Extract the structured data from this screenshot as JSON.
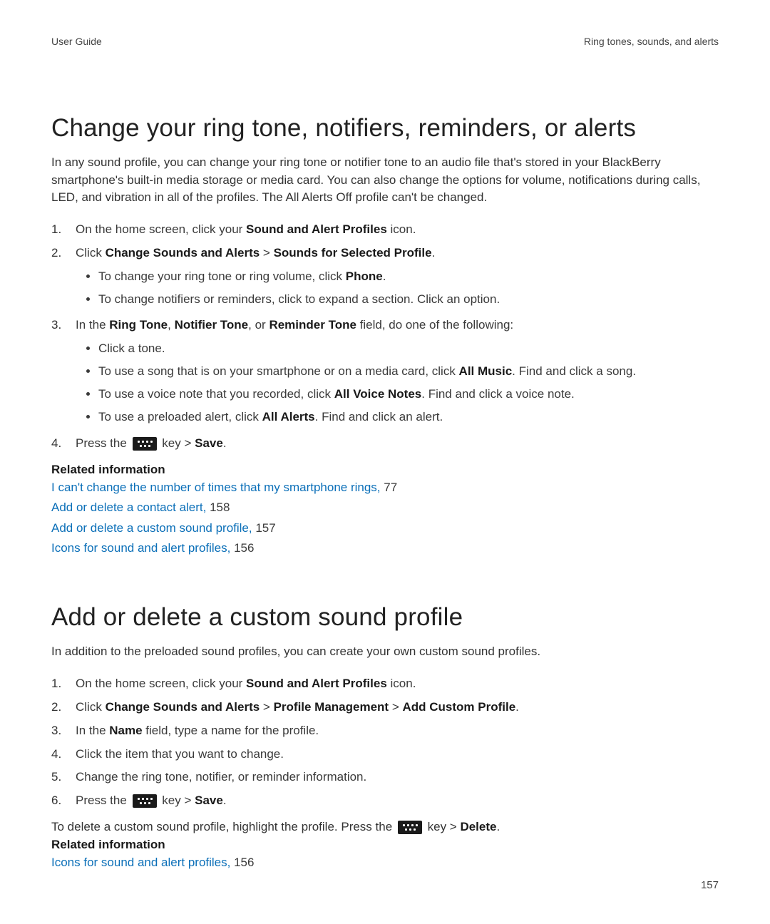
{
  "header": {
    "left": "User Guide",
    "right": "Ring tones, sounds, and alerts"
  },
  "page_number": "157",
  "s1": {
    "title": "Change your ring tone, notifiers, reminders, or alerts",
    "intro": "In any sound profile, you can change your ring tone or notifier tone to an audio file that's stored in your BlackBerry smartphone's built-in media storage or media card. You can also change the options for volume, notifications during calls, LED, and vibration in all of the profiles. The All Alerts Off profile can't be changed.",
    "step1": {
      "n": "1.",
      "a": "On the home screen, click your ",
      "b": "Sound and Alert Profiles",
      "c": " icon."
    },
    "step2": {
      "n": "2.",
      "a": "Click ",
      "b": "Change Sounds and Alerts",
      "sep": " > ",
      "c": "Sounds for Selected Profile",
      "d": ".",
      "sub1": {
        "a": "To change your ring tone or ring volume, click ",
        "b": "Phone",
        "c": "."
      },
      "sub2": "To change notifiers or reminders, click to expand a section. Click an option."
    },
    "step3": {
      "n": "3.",
      "a": "In the ",
      "b": "Ring Tone",
      "sep1": ", ",
      "c": "Notifier Tone",
      "sep2": ", or ",
      "d": "Reminder Tone",
      "e": " field, do one of the following:",
      "sub1": "Click a tone.",
      "sub2": {
        "a": "To use a song that is on your smartphone or on a media card, click ",
        "b": "All Music",
        "c": ". Find and click a song."
      },
      "sub3": {
        "a": "To use a voice note that you recorded, click ",
        "b": "All Voice Notes",
        "c": ". Find and click a voice note."
      },
      "sub4": {
        "a": "To use a preloaded alert, click ",
        "b": "All Alerts",
        "c": ". Find and click an alert."
      }
    },
    "step4": {
      "n": "4.",
      "a": "Press the ",
      "b": " key > ",
      "c": "Save",
      "d": "."
    },
    "rel_h": "Related information",
    "rel1": {
      "link": "I can't change the number of times that my smartphone rings, ",
      "pg": "77"
    },
    "rel2": {
      "link": "Add or delete a contact alert, ",
      "pg": "158"
    },
    "rel3": {
      "link": "Add or delete a custom sound profile, ",
      "pg": "157"
    },
    "rel4": {
      "link": "Icons for sound and alert profiles, ",
      "pg": "156"
    }
  },
  "s2": {
    "title": "Add or delete a custom sound profile",
    "intro": "In addition to the preloaded sound profiles, you can create your own custom sound profiles.",
    "step1": {
      "n": "1.",
      "a": "On the home screen, click your ",
      "b": "Sound and Alert Profiles",
      "c": " icon."
    },
    "step2": {
      "n": "2.",
      "a": "Click ",
      "b": "Change Sounds and Alerts",
      "sep1": " > ",
      "c": "Profile Management",
      "sep2": " > ",
      "d": "Add Custom Profile",
      "e": "."
    },
    "step3": {
      "n": "3.",
      "a": "In the ",
      "b": "Name",
      "c": " field, type a name for the profile."
    },
    "step4": {
      "n": "4.",
      "a": "Click the item that you want to change."
    },
    "step5": {
      "n": "5.",
      "a": "Change the ring tone, notifier, or reminder information."
    },
    "step6": {
      "n": "6.",
      "a": "Press the ",
      "b": " key > ",
      "c": "Save",
      "d": "."
    },
    "delete": {
      "a": "To delete a custom sound profile, highlight the profile. Press the ",
      "b": " key > ",
      "c": "Delete",
      "d": "."
    },
    "rel_h": "Related information",
    "rel1": {
      "link": "Icons for sound and alert profiles, ",
      "pg": "156"
    }
  }
}
